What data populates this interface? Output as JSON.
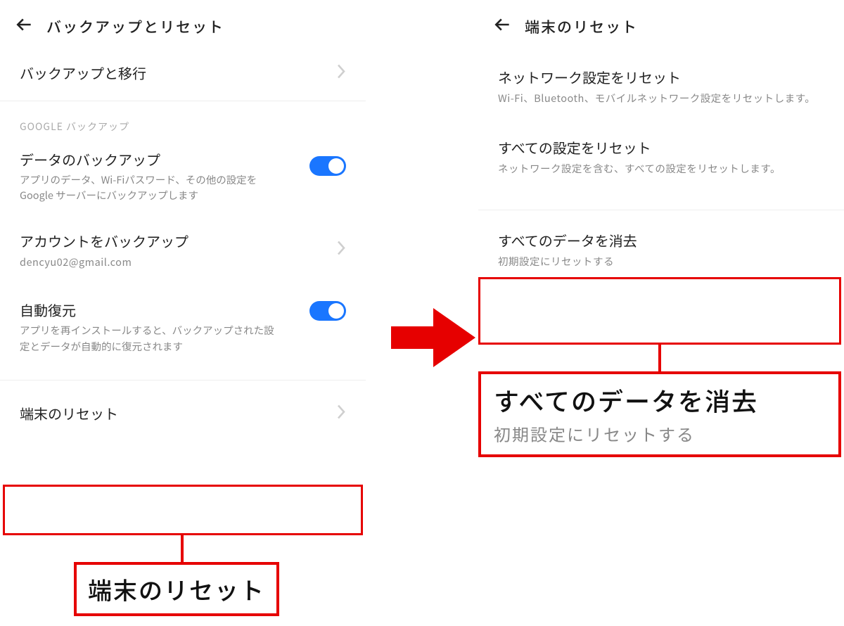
{
  "colors": {
    "accent_blue": "#1a76ff",
    "annotation_red": "#e60000"
  },
  "left": {
    "appbar_title": "バックアップとリセット",
    "backup_migrate": {
      "title": "バックアップと移行"
    },
    "google_section_label": "GOOGLE バックアップ",
    "data_backup": {
      "title": "データのバックアップ",
      "sub": "アプリのデータ、Wi‑Fiパスワード、その他の設定を Google サーバーにバックアップします",
      "toggle_on": true
    },
    "account_backup": {
      "title": "アカウントをバックアップ",
      "sub": "dencyu02@gmail.com"
    },
    "auto_restore": {
      "title": "自動復元",
      "sub": "アプリを再インストールすると、バックアップされた設定とデータが自動的に復元されます",
      "toggle_on": true
    },
    "device_reset": {
      "title": "端末のリセット"
    },
    "callout": "端末のリセット"
  },
  "right": {
    "appbar_title": "端末のリセット",
    "reset_network": {
      "title": "ネットワーク設定をリセット",
      "sub": "Wi‑Fi、Bluetooth、モバイルネットワーク設定をリセットします。"
    },
    "reset_all_settings": {
      "title": "すべての設定をリセット",
      "sub": "ネットワーク設定を含む、すべての設定をリセットします。"
    },
    "erase_all": {
      "title": "すべてのデータを消去",
      "sub": "初期設定にリセットする"
    },
    "callout_title": "すべてのデータを消去",
    "callout_sub": "初期設定にリセットする"
  }
}
